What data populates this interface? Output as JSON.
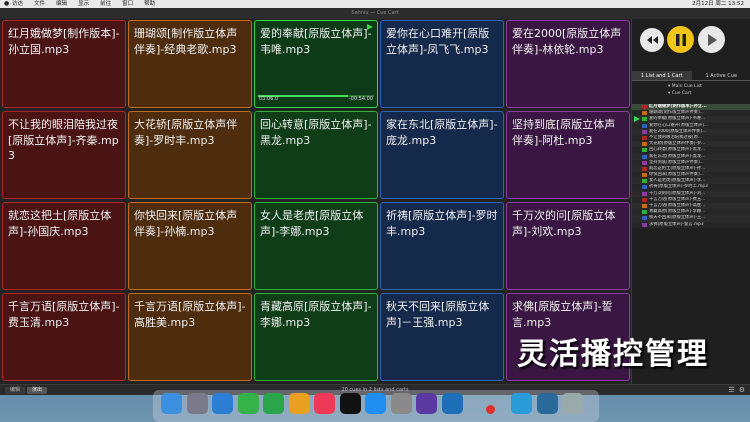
{
  "menubar": {
    "apple": "",
    "items": [
      "访达",
      "文件",
      "编辑",
      "显示",
      "前往",
      "窗口",
      "帮助"
    ],
    "clock": "2月12日 周二 13:52"
  },
  "window": {
    "title": "Sahniu — Cue Cart"
  },
  "colors": {
    "red": {
      "bg": "#4a1414",
      "border": "#b02525"
    },
    "orange": {
      "bg": "#4e2c0e",
      "border": "#c56b16"
    },
    "green": {
      "bg": "#0e3d17",
      "border": "#2eb23b"
    },
    "blue": {
      "bg": "#15294a",
      "border": "#2e62b8"
    },
    "purple": {
      "bg": "#3a1742",
      "border": "#8d3aa6"
    }
  },
  "grid": [
    {
      "label": "红月娥做梦[制作版本]-孙立国.mp3",
      "color": "red"
    },
    {
      "label": "珊瑚颂[制作版立体声伴奏]-经典老歌.mp3",
      "color": "orange"
    },
    {
      "label": "爱的奉献[原版立体声]-韦唯.mp3",
      "color": "green",
      "active": true,
      "elapsed": "03:06.0",
      "remaining": "-00:54.00",
      "progress": 0.78
    },
    {
      "label": "爱你在心口难开[原版立体声]-凤飞飞.mp3",
      "color": "blue"
    },
    {
      "label": "爱在2000[原版立体声伴奏]-林依轮.mp3",
      "color": "purple"
    },
    {
      "label": "不让我的眼泪陪我过夜[原版立体声]-齐秦.mp3",
      "color": "red"
    },
    {
      "label": "大花轿[原版立体声伴奏]-罗时丰.mp3",
      "color": "orange"
    },
    {
      "label": "回心转意[原版立体声]-黑龙.mp3",
      "color": "green"
    },
    {
      "label": "家在东北[原版立体声]-庞龙.mp3",
      "color": "blue"
    },
    {
      "label": "坚持到底[原版立体声伴奏]-阿杜.mp3",
      "color": "purple"
    },
    {
      "label": "就恋这把土[原版立体声]-孙国庆.mp3",
      "color": "red"
    },
    {
      "label": "你快回来[原版立体声伴奏]-孙楠.mp3",
      "color": "orange"
    },
    {
      "label": "女人是老虎[原版立体声]-李娜.mp3",
      "color": "green"
    },
    {
      "label": "祈祷[原版立体声]-罗时丰.mp3",
      "color": "blue"
    },
    {
      "label": "千万次的问[原版立体声]-刘欢.mp3",
      "color": "purple"
    },
    {
      "label": "千言万语[原版立体声]-费玉清.mp3",
      "color": "red"
    },
    {
      "label": "千言万语[原版立体声]-高胜美.mp3",
      "color": "orange"
    },
    {
      "label": "青藏高原[原版立体声]-李娜.mp3",
      "color": "green"
    },
    {
      "label": "秋天不回来[原版立体声]－王强.mp3",
      "color": "blue"
    },
    {
      "label": "求佛[原版立体声]-誓言.mp3",
      "color": "purple"
    }
  ],
  "panel": {
    "tabs": [
      "1 List and 1 Cart",
      "1 Active Cue"
    ],
    "tree": [
      "Main Cue List",
      "Cue Cart"
    ],
    "cue_list": [
      {
        "label": "红月娥做梦[制作版本]-孙立...",
        "color": "red",
        "now": true
      },
      {
        "label": "珊瑚颂[制作版立体声伴奏]...",
        "color": "orange"
      },
      {
        "label": "爱的奉献[原版立体声]-韦唯...",
        "color": "green",
        "playing": true
      },
      {
        "label": "爱你在心口难开[原版立体声]...",
        "color": "blue"
      },
      {
        "label": "爱在2000[原版立体声伴奏]...",
        "color": "purple"
      },
      {
        "label": "不让我的眼泪陪我过夜[原...",
        "color": "red"
      },
      {
        "label": "大花轿[原版立体声伴奏]-罗...",
        "color": "orange"
      },
      {
        "label": "回心转意[原版立体声]-黑龙...",
        "color": "green"
      },
      {
        "label": "家在东北[原版立体声]-庞龙...",
        "color": "blue"
      },
      {
        "label": "坚持到底[原版立体声伴奏]...",
        "color": "purple"
      },
      {
        "label": "就恋这把土[原版立体声]-孙...",
        "color": "red"
      },
      {
        "label": "你快回来[原版立体声伴奏]...",
        "color": "orange"
      },
      {
        "label": "女人是老虎[原版立体声]-李...",
        "color": "green"
      },
      {
        "label": "祈祷[原版立体声]-罗时丰.mp3",
        "color": "blue"
      },
      {
        "label": "千万次的问[原版立体声]-刘...",
        "color": "purple"
      },
      {
        "label": "千言万语[原版立体声]-费玉...",
        "color": "red"
      },
      {
        "label": "千言万语[原版立体声]-高胜...",
        "color": "orange"
      },
      {
        "label": "青藏高原[原版立体声]-李娜...",
        "color": "green"
      },
      {
        "label": "秋天不回来[原版立体声]-王...",
        "color": "blue"
      },
      {
        "label": "求佛[原版立体声]-誓言.mp3",
        "color": "purple"
      }
    ]
  },
  "status": {
    "modes": [
      "编辑",
      "演出"
    ],
    "count": "20 cues in 2 lists and carts"
  },
  "watermark": "灵活播控管理",
  "dock": {
    "apps": [
      "finder",
      "launchpad",
      "safari",
      "messages",
      "facetime",
      "photos",
      "music",
      "tv",
      "app-store",
      "system-preferences",
      "qlab",
      "mosaic",
      "folder",
      "downloads",
      "trash"
    ]
  }
}
